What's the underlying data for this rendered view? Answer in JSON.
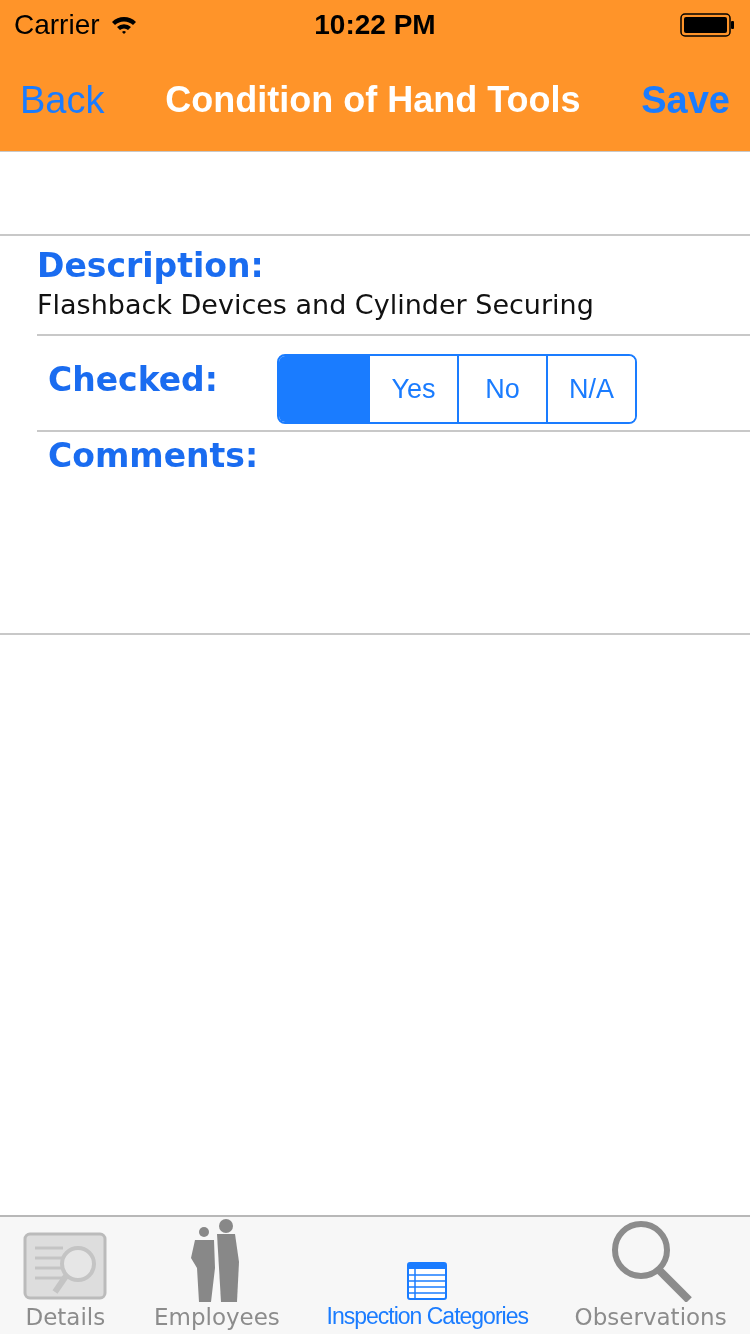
{
  "status_bar": {
    "carrier": "Carrier",
    "time": "10:22 PM"
  },
  "nav": {
    "back": "Back",
    "title": "Condition of Hand Tools",
    "save": "Save"
  },
  "description": {
    "label": "Description:",
    "value": "Flashback Devices and Cylinder Securing"
  },
  "checked": {
    "label": "Checked:",
    "segments": [
      {
        "selected": true
      },
      {
        "label": "Yes",
        "selected": false
      },
      {
        "label": "No",
        "selected": false
      },
      {
        "label": "N/A",
        "selected": false
      }
    ]
  },
  "comments": {
    "label": "Comments:"
  },
  "tabs": [
    {
      "label": "Details",
      "kind": "details",
      "selected": false
    },
    {
      "label": "Employees",
      "kind": "people",
      "selected": false
    },
    {
      "label": "Inspection Categories",
      "kind": "list",
      "selected": true
    },
    {
      "label": "Observations",
      "kind": "search",
      "selected": false
    }
  ]
}
